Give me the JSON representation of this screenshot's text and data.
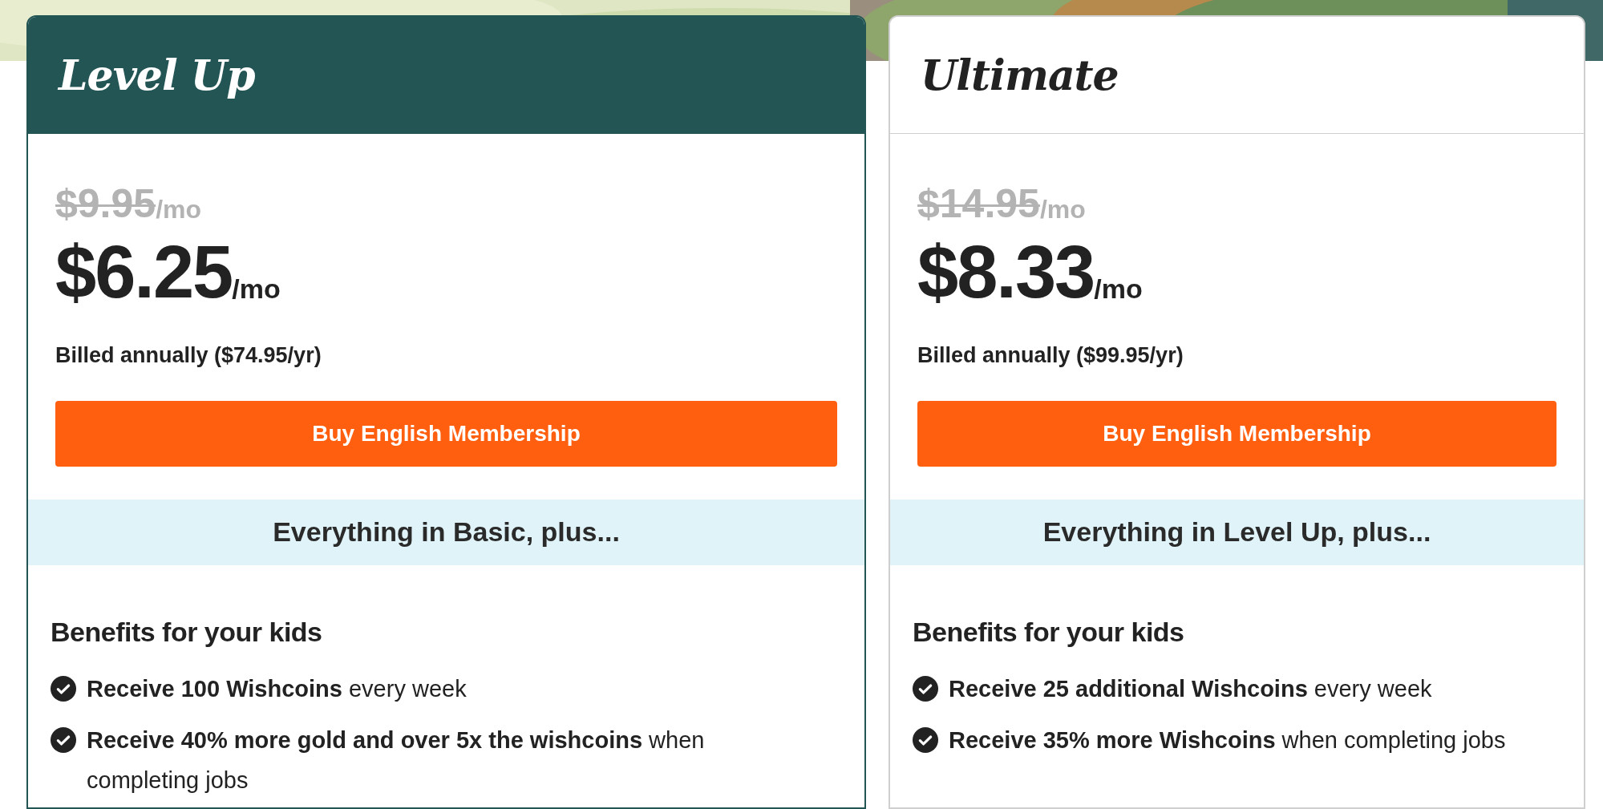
{
  "plans": [
    {
      "title": "Level Up",
      "kind": "dark",
      "old_price": "$9.95",
      "old_unit": "/mo",
      "price": "$6.25",
      "unit": "/mo",
      "billed": "Billed annually ($74.95/yr)",
      "button": "Buy English Membership",
      "intro": "Everything in Basic, plus...",
      "section_heading": "Benefits for your kids",
      "benefits": [
        "**Receive 100 Wishcoins** every week",
        "**Receive 40% more gold and over 5x the wishcoins** when completing jobs"
      ]
    },
    {
      "title": "Ultimate",
      "kind": "light",
      "old_price": "$14.95",
      "old_unit": "/mo",
      "price": "$8.33",
      "unit": "/mo",
      "billed": "Billed annually ($99.95/yr)",
      "button": "Buy English Membership",
      "intro": "Everything in Level Up, plus...",
      "section_heading": "Benefits for your kids",
      "benefits": [
        "**Receive 25 additional Wishcoins** every week",
        "**Receive 35% more Wishcoins** when completing jobs"
      ]
    }
  ]
}
